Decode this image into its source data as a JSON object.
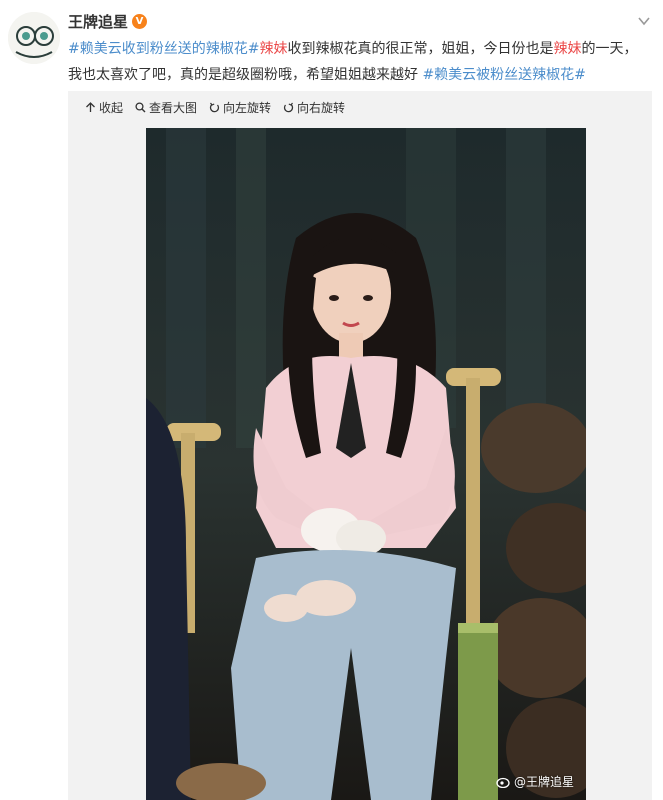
{
  "user": {
    "name": "王牌追星",
    "badge": "V"
  },
  "post": {
    "segments": [
      {
        "text": "#赖美云收到粉丝送的辣椒花#",
        "style": "hashtag"
      },
      {
        "text": "辣妹",
        "style": "red"
      },
      {
        "text": "收到辣椒花真的很正常，姐姐，今日份也是",
        "style": "plain"
      },
      {
        "text": "辣妹",
        "style": "red"
      },
      {
        "text": "的一天，我也太喜欢了吧，真的是超级圈粉哦，希望姐姐越来越好 ",
        "style": "plain"
      },
      {
        "text": "#赖美云被粉丝送辣椒花#",
        "style": "hashtag"
      }
    ]
  },
  "toolbar": {
    "collapse": "收起",
    "view_large": "查看大图",
    "rotate_left": "向左旋转",
    "rotate_right": "向右旋转"
  },
  "photo": {
    "watermark": "@王牌追星"
  },
  "colors": {
    "hashtag": "#4c8dcb",
    "highlight": "#eb4a4a",
    "badge": "#f7821b"
  }
}
